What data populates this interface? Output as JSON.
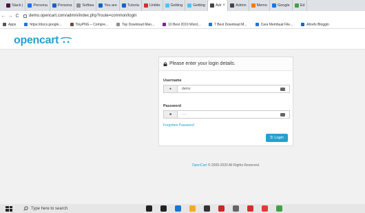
{
  "browser": {
    "tabs": [
      {
        "label": "Slack |",
        "color": "#4a154b"
      },
      {
        "label": "Persona",
        "color": "#1a73e8"
      },
      {
        "label": "Persona",
        "color": "#1565c0"
      },
      {
        "label": "Softwa",
        "color": "#8e8e8e"
      },
      {
        "label": "You are",
        "color": "#1565c0"
      },
      {
        "label": "Tutoria",
        "color": "#1565c0"
      },
      {
        "label": "Unitite",
        "color": "#d32f2f"
      },
      {
        "label": "Getting",
        "color": "#4fc3f7"
      },
      {
        "label": "Getting",
        "color": "#4fc3f7"
      },
      {
        "label": "Adr",
        "color": "#444444",
        "active": true
      },
      {
        "label": "Admin",
        "color": "#444444"
      },
      {
        "label": "Memo",
        "color": "#f57c00"
      },
      {
        "label": "Google",
        "color": "#1a73e8"
      },
      {
        "label": "Ed",
        "color": "#43a047"
      }
    ],
    "close_glyph": "×",
    "back_glyph": "←",
    "forward_glyph": "→",
    "reload_glyph": "C",
    "url": "demo.opencart.com/admin/index.php?route=common/login"
  },
  "bookmarks": [
    {
      "label": "Apps",
      "color": "#555555"
    },
    {
      "label": "https://docs.google...",
      "color": "#1a73e8"
    },
    {
      "label": "TinyPNG – Compre...",
      "color": "#6d4c41"
    },
    {
      "label": "Top Download Man...",
      "color": "#8e8e8e"
    },
    {
      "label": "10 Best 2019 Word...",
      "color": "#7b1fa2"
    },
    {
      "label": "7 Best Download M...",
      "color": "#1976d2"
    },
    {
      "label": "Cara Membuat File...",
      "color": "#1a73e8"
    },
    {
      "label": "Ahrefs Bloggin",
      "color": "#1565c0"
    }
  ],
  "opencart": {
    "logo": "opencart",
    "brand_color": "#23a1d1"
  },
  "login": {
    "heading": "Please enter your login details.",
    "username_label": "Username",
    "username_value": "demo",
    "password_label": "Password",
    "password_value": "····",
    "forgot_link": "Forgotten Password",
    "button_label": "Login"
  },
  "footer": {
    "link": "OpenCart",
    "text": " © 2009-2020 All Rights Reserved."
  },
  "taskbar": {
    "search_placeholder": "Type here to search",
    "icons": [
      {
        "name": "cortana-icon",
        "color": "#222222"
      },
      {
        "name": "task-view-icon",
        "color": "#222222"
      },
      {
        "name": "edge-icon",
        "color": "#1976d2"
      },
      {
        "name": "file-explorer-icon",
        "color": "#f9a825"
      },
      {
        "name": "store-icon",
        "color": "#333333"
      },
      {
        "name": "mail-icon",
        "color": "#c62828"
      },
      {
        "name": "app-icon",
        "color": "#666666"
      },
      {
        "name": "opera-icon",
        "color": "#d32f2f"
      },
      {
        "name": "app2-icon",
        "color": "#e53935"
      },
      {
        "name": "chrome-icon",
        "color": "#43a047"
      }
    ]
  }
}
